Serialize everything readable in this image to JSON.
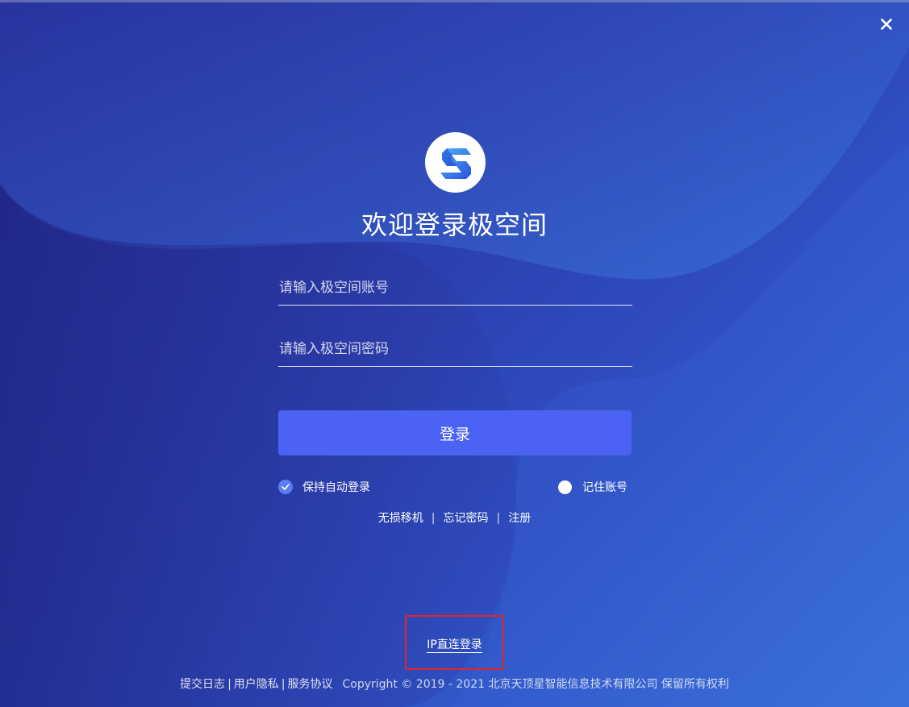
{
  "window": {
    "close_icon": "close-icon"
  },
  "brand": {
    "logo_icon": "jikongjian-logo-icon",
    "title": "欢迎登录极空间"
  },
  "form": {
    "account_placeholder": "请输入极空间账号",
    "account_value": "",
    "password_placeholder": "请输入极空间密码",
    "password_value": "",
    "login_label": "登录",
    "keep_login_label": "保持自动登录",
    "keep_login_checked": true,
    "remember_label": "记住账号",
    "remember_checked": false
  },
  "links": {
    "migrate": "无损移机",
    "forgot": "忘记密码",
    "register": "注册",
    "separator": "|"
  },
  "ip_login": {
    "label": "IP直连登录",
    "highlight_color": "#e0262c"
  },
  "footer": {
    "log": "提交日志",
    "privacy": "用户隐私",
    "agreement": "服务协议",
    "separator": "|",
    "copyright": "Copyright © 2019 - 2021 北京天顶星智能信息技术有限公司 保留所有权利"
  },
  "colors": {
    "accent": "#4a63f2",
    "checkbox": "#5c7cf5",
    "text": "#ffffff"
  }
}
